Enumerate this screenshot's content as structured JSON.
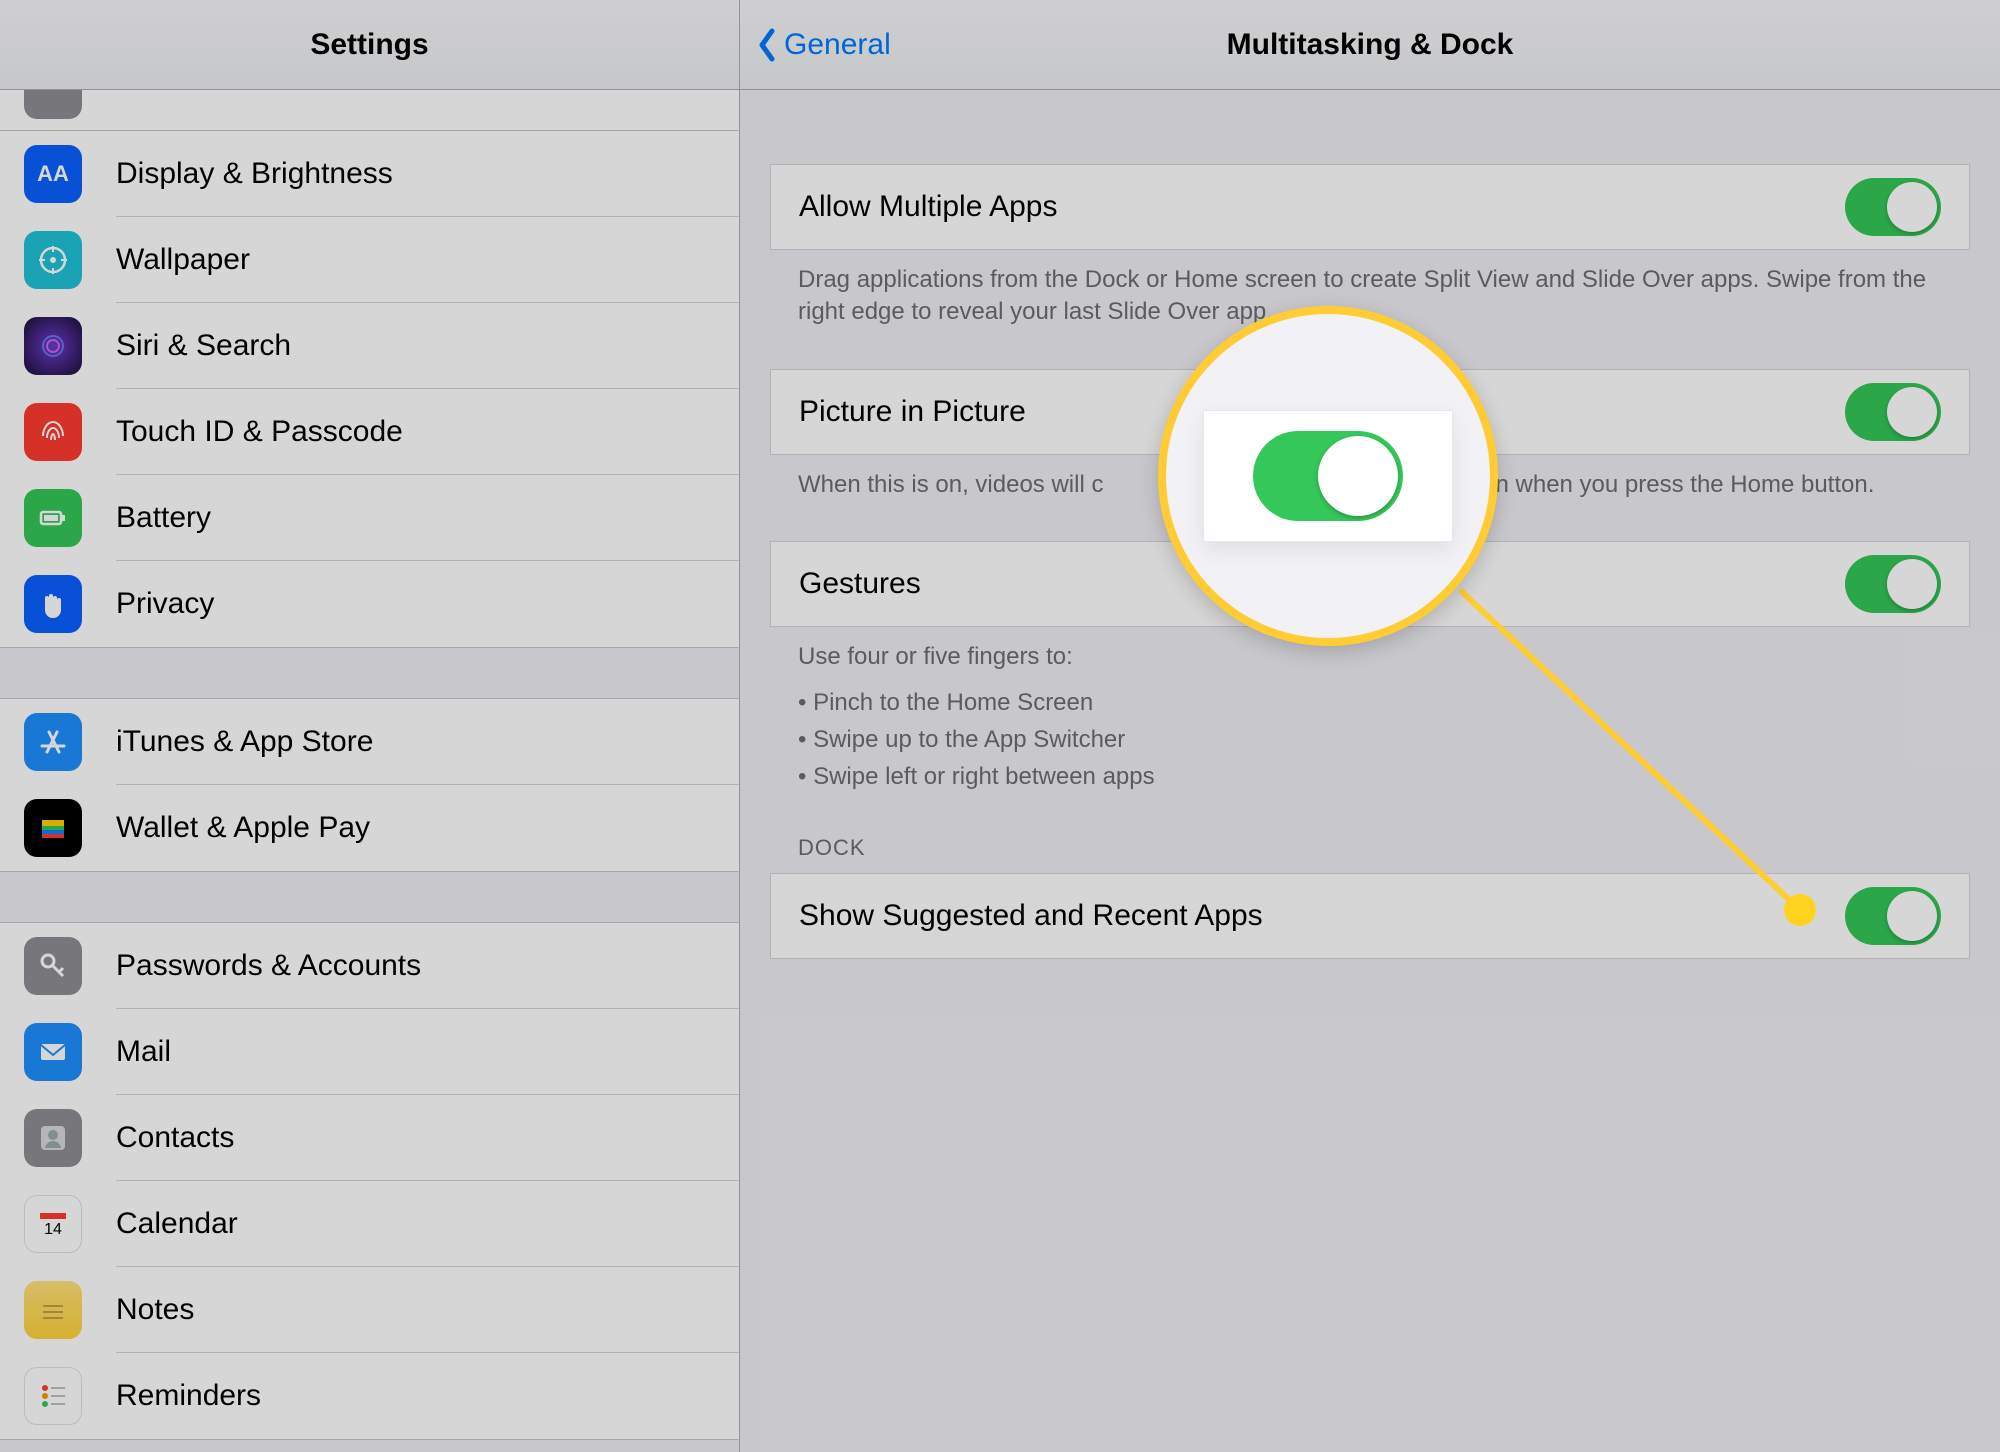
{
  "sidebar": {
    "title": "Settings",
    "groups": [
      {
        "items": [
          {
            "id": "display",
            "label": "Display & Brightness"
          },
          {
            "id": "wallpaper",
            "label": "Wallpaper"
          },
          {
            "id": "siri",
            "label": "Siri & Search"
          },
          {
            "id": "touchid",
            "label": "Touch ID & Passcode"
          },
          {
            "id": "battery",
            "label": "Battery"
          },
          {
            "id": "privacy",
            "label": "Privacy"
          }
        ]
      },
      {
        "items": [
          {
            "id": "appstore",
            "label": "iTunes & App Store"
          },
          {
            "id": "wallet",
            "label": "Wallet & Apple Pay"
          }
        ]
      },
      {
        "items": [
          {
            "id": "passwords",
            "label": "Passwords & Accounts"
          },
          {
            "id": "mail",
            "label": "Mail"
          },
          {
            "id": "contacts",
            "label": "Contacts"
          },
          {
            "id": "calendar",
            "label": "Calendar"
          },
          {
            "id": "notes",
            "label": "Notes"
          },
          {
            "id": "reminders",
            "label": "Reminders"
          }
        ]
      }
    ]
  },
  "detail": {
    "back_label": "General",
    "title": "Multitasking & Dock",
    "allow_multiple": {
      "title": "Allow Multiple Apps",
      "on": true,
      "caption": "Drag applications from the Dock or Home screen to create Split View and Slide Over apps. Swipe from the right edge to reveal your last Slide Over app."
    },
    "pip": {
      "title": "Picture in Picture",
      "on": true,
      "caption_prefix": "When this is on, videos will c",
      "caption_suffix": "even when you press the Home button."
    },
    "gestures": {
      "title": "Gestures",
      "on": true,
      "caption_lead": "Use four or five fingers to:",
      "bullets": [
        "Pinch to the Home Screen",
        "Swipe up to the App Switcher",
        "Swipe left or right between apps"
      ]
    },
    "dock_section": "DOCK",
    "suggested": {
      "title": "Show Suggested and Recent Apps",
      "on": true
    }
  }
}
